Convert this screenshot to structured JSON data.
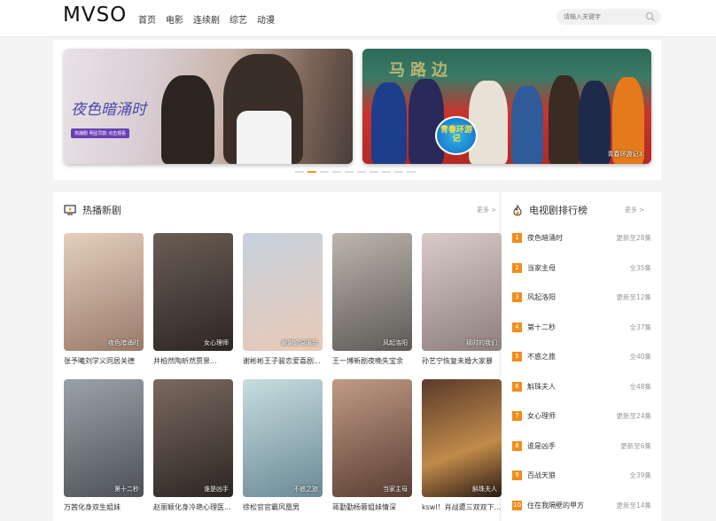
{
  "header": {
    "logo": "MVSO",
    "nav": [
      "首页",
      "电影",
      "连续剧",
      "综艺",
      "动漫"
    ],
    "search_placeholder": "请输入关键字"
  },
  "banners": [
    {
      "title_art": "夜色暗涌时",
      "tag": "热播剧 明星同款 点击观看",
      "caption": ""
    },
    {
      "title_art": "",
      "sign": "马路边",
      "badge": "青春环游记",
      "caption": "青春环游记3"
    }
  ],
  "hot": {
    "title": "热播新剧",
    "more": "更多 >",
    "items": [
      {
        "poster_label": "夜色暗涌时",
        "caption": "张予曦刘学义同居关德",
        "bg": "#c9a88f"
      },
      {
        "poster_label": "女心理师",
        "caption": "井柏然陶昕然贾景...",
        "bg": "#5c4f4a"
      },
      {
        "poster_label": "谢谢你温暖我",
        "caption": "谢彬彬王子骏恋爱喜剧...",
        "bg": "#a8b8c8"
      },
      {
        "poster_label": "风起洛阳",
        "caption": "王一博新剧夜晚失宝余",
        "bg": "#8c8c8c"
      },
      {
        "poster_label": "那时的我们",
        "caption": "孙艺宁恢复未婚大家暴",
        "bg": "#d7c3c0"
      },
      {
        "poster_label": "第十二秒",
        "caption": "万茜化身双生姐妹",
        "bg": "#8a8f95"
      },
      {
        "poster_label": "谁是凶手",
        "caption": "赵丽颖化身冷艳心理医...",
        "bg": "#6b5a52"
      },
      {
        "poster_label": "不惑之旅",
        "caption": "徐松官官霸风凰男",
        "bg": "#a9c4c9"
      },
      {
        "poster_label": "当家主母",
        "caption": "蒋勤勤杨蓉姐妹情深",
        "bg": "#a0786a"
      },
      {
        "poster_label": "斛珠夫人",
        "caption": "kswl！肖战遭三双双下...",
        "bg": "#4c2e22"
      }
    ]
  },
  "ranking": {
    "title": "电视剧排行榜",
    "more": "更多 >",
    "items": [
      {
        "num": "1",
        "name": "夜色暗涌时",
        "status": "更新至28集"
      },
      {
        "num": "2",
        "name": "当家主母",
        "status": "全35集"
      },
      {
        "num": "3",
        "name": "风起洛阳",
        "status": "更新至12集"
      },
      {
        "num": "4",
        "name": "第十二秒",
        "status": "全37集"
      },
      {
        "num": "5",
        "name": "不惑之旅",
        "status": "全40集"
      },
      {
        "num": "6",
        "name": "斛珠夫人",
        "status": "全48集"
      },
      {
        "num": "7",
        "name": "女心理师",
        "status": "更新至24集"
      },
      {
        "num": "8",
        "name": "谁是凶手",
        "status": "更新至6集"
      },
      {
        "num": "9",
        "name": "百战天狼",
        "status": "全39集"
      },
      {
        "num": "10",
        "name": "住在我隔壁的甲方",
        "status": "更新至14集"
      }
    ]
  }
}
